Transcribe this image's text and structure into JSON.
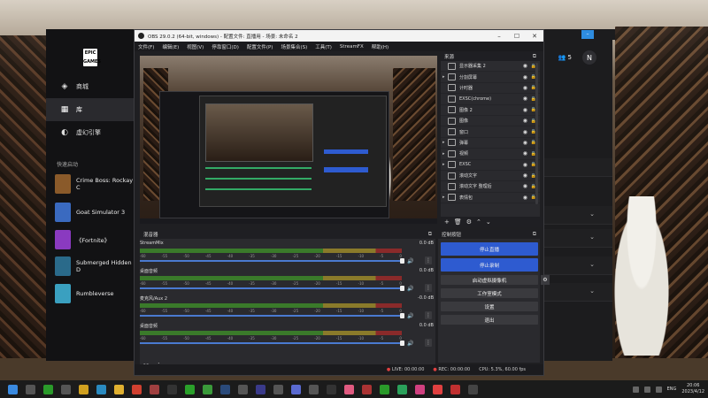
{
  "epic": {
    "logo": "EPIC\nGAMES",
    "nav": [
      {
        "label": "商城",
        "icon": "tag-icon"
      },
      {
        "label": "库",
        "icon": "grid-icon"
      },
      {
        "label": "虚幻引擎",
        "icon": "unreal-icon"
      }
    ],
    "quick_title": "快速启动",
    "quick_items": [
      {
        "label": "Crime Boss: Rockay C",
        "color": "#8a5a2a"
      },
      {
        "label": "Goat Simulator 3",
        "color": "#3a6ac0"
      },
      {
        "label": "《Fortnite》",
        "color": "#8a3ac0"
      },
      {
        "label": "Submerged Hidden D",
        "color": "#2a6a8a"
      },
      {
        "label": "Rumbleverse",
        "color": "#3aa0c0"
      }
    ],
    "friends_count": "5",
    "avatar_letter": "N"
  },
  "obs": {
    "title": "OBS 29.0.2 (64-bit, windows) - 配置文件: 直播用 - 场景: 未命名 2",
    "menu": [
      "文件(F)",
      "编辑(E)",
      "视图(V)",
      "停靠窗口(D)",
      "配置文件(P)",
      "场景集合(S)",
      "工具(T)",
      "StreamFX",
      "帮助(H)"
    ],
    "sources_title": "来源",
    "sources": [
      {
        "label": "显示器采集 2",
        "arrow": "",
        "selected": true
      },
      {
        "label": "分割屏幕",
        "arrow": "▸"
      },
      {
        "label": "计时器",
        "arrow": ""
      },
      {
        "label": "EXSC(chrome)",
        "arrow": ""
      },
      {
        "label": "图像 2",
        "arrow": ""
      },
      {
        "label": "图像",
        "arrow": ""
      },
      {
        "label": "窗口",
        "arrow": ""
      },
      {
        "label": "弹幕",
        "arrow": "▸"
      },
      {
        "label": "视频",
        "arrow": "▸"
      },
      {
        "label": "EXSC",
        "arrow": "▸"
      },
      {
        "label": "滚动文字",
        "arrow": ""
      },
      {
        "label": "滚动文字 整理后",
        "arrow": ""
      },
      {
        "label": "表情包",
        "arrow": "▸"
      }
    ],
    "mixer_title": "混音器",
    "channels": [
      {
        "name": "StreamMix",
        "db": "0.0 dB"
      },
      {
        "name": "桌面音频",
        "db": "0.0 dB"
      },
      {
        "name": "麦克风/Aux 2",
        "db": "-0.0 dB"
      },
      {
        "name": "桌面音频",
        "db": "0.0 dB"
      }
    ],
    "ticks": [
      "-60",
      "-55",
      "-50",
      "-45",
      "-40",
      "-35",
      "-30",
      "-25",
      "-20",
      "-15",
      "-10",
      "-5",
      "0"
    ],
    "controls_title": "控制按钮",
    "controls": {
      "stop_stream": "停止直播",
      "start_record": "停止录制",
      "virtual_cam": "启动虚拟摄像机",
      "studio_mode": "工作室模式",
      "settings": "设置",
      "exit": "退出"
    },
    "status": {
      "live": "LIVE: 00:00:00",
      "rec": "REC: 00:00:00",
      "cpu": "CPU: 5.3%, 60.00 fps"
    }
  },
  "taskbar": {
    "icons": [
      {
        "name": "start-icon",
        "color": "#3a8ae0"
      },
      {
        "name": "search-icon",
        "color": "#555"
      },
      {
        "name": "xbox-icon",
        "color": "#2a9a2a"
      },
      {
        "name": "widgets-icon",
        "color": "#555"
      },
      {
        "name": "files-icon",
        "color": "#d0a020"
      },
      {
        "name": "edge-icon",
        "color": "#2a8ac0"
      },
      {
        "name": "folder-icon",
        "color": "#e0b030"
      },
      {
        "name": "chrome-icon",
        "color": "#d04030"
      },
      {
        "name": "app-icon",
        "color": "#a04040"
      },
      {
        "name": "obs-icon",
        "color": "#333"
      },
      {
        "name": "wechat-icon",
        "color": "#2aa02a"
      },
      {
        "name": "chat-icon",
        "color": "#3a9a3a"
      },
      {
        "name": "steam-icon",
        "color": "#2a4a7a"
      },
      {
        "name": "camera-icon",
        "color": "#555"
      },
      {
        "name": "game-icon",
        "color": "#3a3a8a"
      },
      {
        "name": "sync-icon",
        "color": "#555"
      },
      {
        "name": "discord-icon",
        "color": "#5a6ad0"
      },
      {
        "name": "app2-icon",
        "color": "#555"
      },
      {
        "name": "epic-icon",
        "color": "#333"
      },
      {
        "name": "bilibili-icon",
        "color": "#e05a80"
      },
      {
        "name": "app3-icon",
        "color": "#aa3333"
      },
      {
        "name": "xbox2-icon",
        "color": "#2a9a2a"
      },
      {
        "name": "app4-icon",
        "color": "#2aa05a"
      },
      {
        "name": "app5-icon",
        "color": "#d04080"
      },
      {
        "name": "app6-icon",
        "color": "#e04040"
      },
      {
        "name": "valorant-icon",
        "color": "#c03030"
      },
      {
        "name": "app7-icon",
        "color": "#444"
      }
    ],
    "lang": "ENG",
    "time": "20:06",
    "date": "2023/4/12"
  }
}
